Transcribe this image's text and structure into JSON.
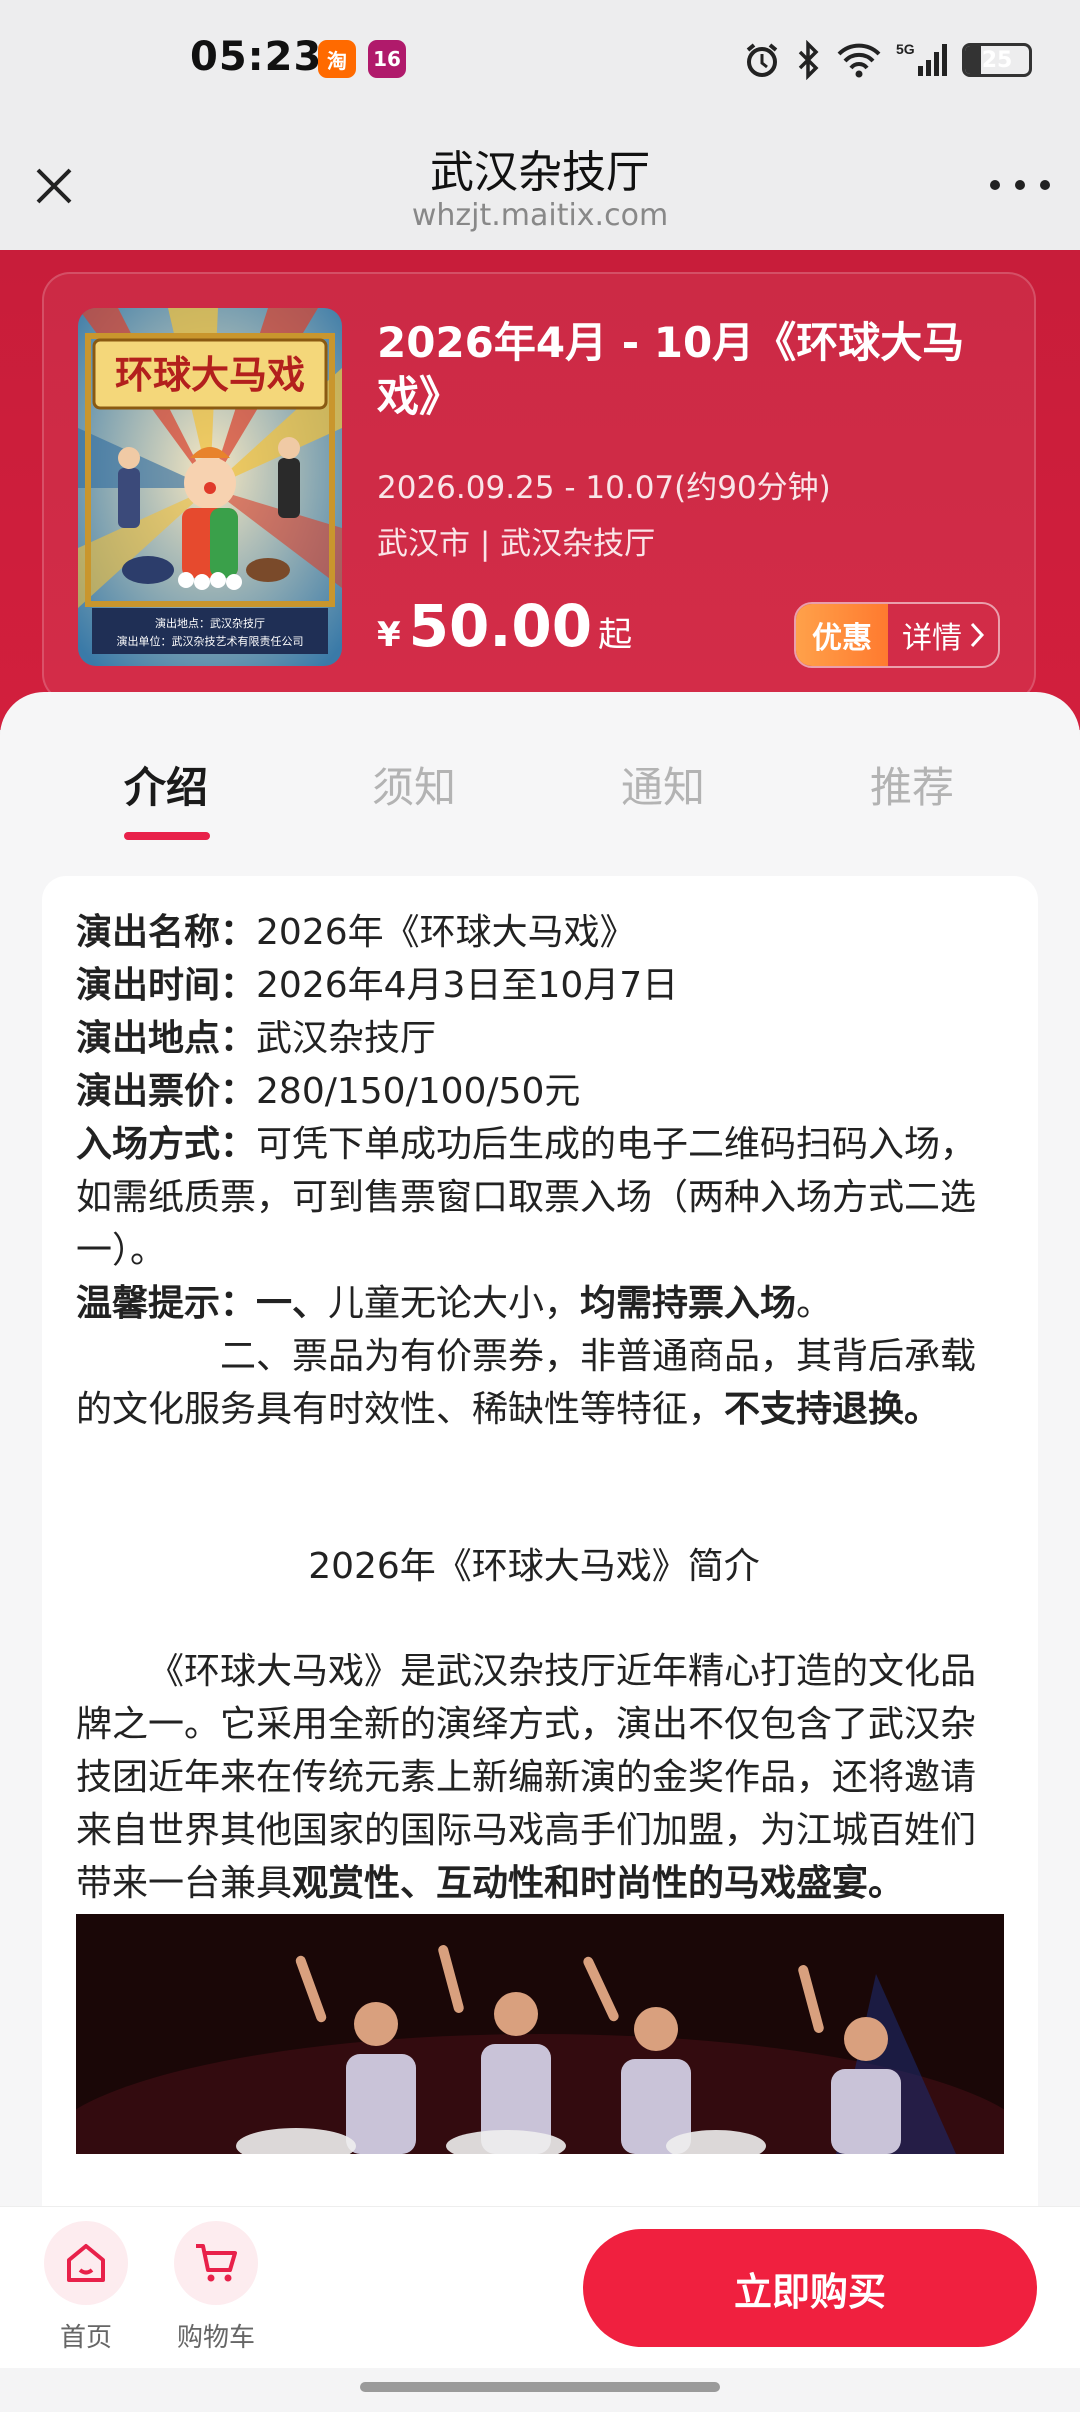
{
  "status_bar": {
    "time": "05:23",
    "app_badges": [
      "淘",
      "16"
    ],
    "network": "5G",
    "battery": "25",
    "battery_level": 0.25
  },
  "title_bar": {
    "title": "武汉杂技厅",
    "url": "whzjt.maitix.com",
    "close_icon": "close-icon",
    "more_icon": "more-icon"
  },
  "event": {
    "title": "2026年4月 - 10月《环球大马戏》",
    "dates": "2026.09.25 - 10.07(约90分钟)",
    "venue": "武汉市 | 武汉杂技厅",
    "price_currency": "¥",
    "price": "50.00",
    "price_suffix": "起",
    "promo_tag": "优惠",
    "promo_detail": "详情",
    "poster": {
      "title": "环球大马戏",
      "line1": "演出地点：武汉杂技厅",
      "line2": "演出单位：武汉杂技艺术有限责任公司"
    }
  },
  "tabs": [
    "介绍",
    "须知",
    "通知",
    "推荐"
  ],
  "details": {
    "name_label": "演出名称：",
    "name_value": "2026年《环球大马戏》",
    "time_label": "演出时间：",
    "time_value": "2026年4月3日至10月7日",
    "location_label": "演出地点：",
    "location_value": "武汉杂技厅",
    "price_label": "演出票价：",
    "price_value": "280/150/100/50元",
    "entry_label": "入场方式：",
    "entry_value": "可凭下单成功后生成的电子二维码扫码入场，如需纸质票，可到售票窗口取票入场（两种入场方式二选一）。",
    "tip_label": "温馨提示：",
    "tip1_prefix": "一、",
    "tip1_text": "儿童无论大小，",
    "tip1_bold": "均需持票入场",
    "tip1_end": "。",
    "tip2_text": "二、票品为有价票券，非普通商品，其背后承载的文化服务具有时效性、稀缺性等特征，",
    "tip2_bold": "不支持退换。"
  },
  "intro": {
    "title": "2026年《环球大马戏》简介",
    "paragraph": "《环球大马戏》是武汉杂技厅近年精心打造的文化品牌之一。它采用全新的演绎方式，演出不仅包含了武汉杂技团近年来在传统元素上新编新演的金奖作品，还将邀请来自世界其他国家的国际马戏高手们加盟，为江城百姓们带来一台兼具",
    "paragraph_bold": "观赏性、互动性和时尚性的马戏盛宴。"
  },
  "bottom_nav": {
    "home_label": "首页",
    "cart_label": "购物车",
    "buy_label": "立即购买"
  },
  "colors": {
    "brand_red": "#d21f3d",
    "button_red": "#f0203f",
    "promo_orange": "#ff8a3a",
    "tab_active_underline": "#e8214a"
  }
}
